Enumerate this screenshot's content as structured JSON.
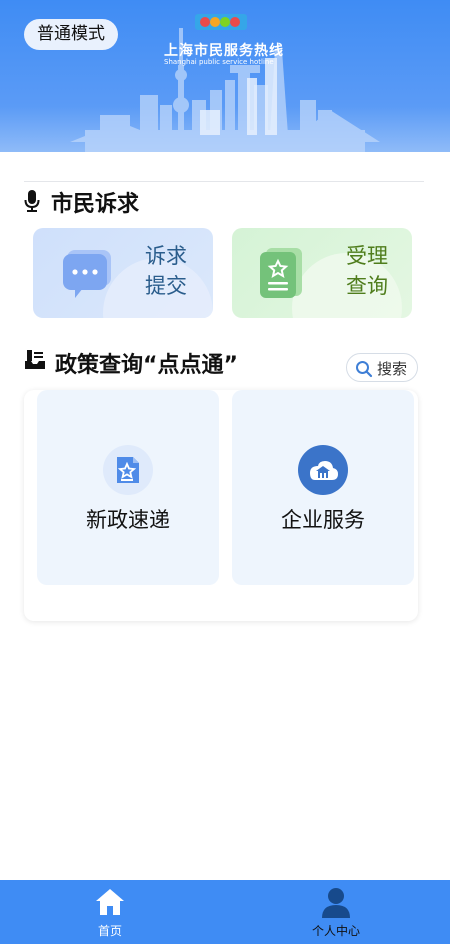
{
  "header": {
    "mode_button": "普通模式",
    "brand_title": "上海市民服务热线",
    "brand_subtitle": "Shanghai public service hotline",
    "logo_text": "12345",
    "bg_color": "#3f8cf4"
  },
  "citizen": {
    "title": "市民诉求",
    "icon": "microphone-icon",
    "cards": [
      {
        "label_line1": "诉求",
        "label_line2": "提交",
        "icon": "chat-bubble-icon",
        "text_color": "#2a5d8c"
      },
      {
        "label_line1": "受理",
        "label_line2": "查询",
        "icon": "document-star-icon",
        "text_color": "#4f7d1c"
      }
    ]
  },
  "policy": {
    "title": "政策查询“点点通”",
    "icon": "inbox-download-icon",
    "search_label": "搜索",
    "cards": [
      {
        "label": "新政速递",
        "icon": "star-document-icon"
      },
      {
        "label": "企业服务",
        "icon": "cloud-building-icon"
      }
    ]
  },
  "tabbar": {
    "items": [
      {
        "label": "首页",
        "icon": "home-icon"
      },
      {
        "label": "个人中心",
        "icon": "user-icon"
      }
    ]
  }
}
